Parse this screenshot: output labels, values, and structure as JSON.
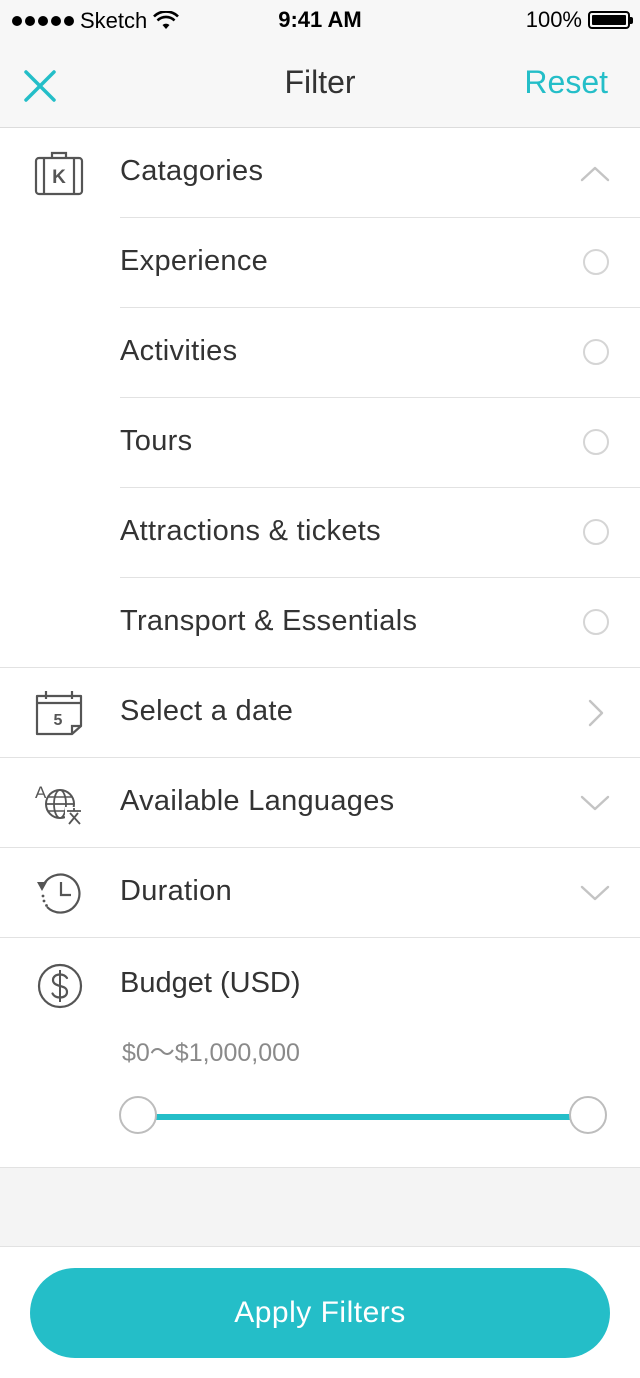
{
  "status_bar": {
    "carrier": "Sketch",
    "time": "9:41 AM",
    "battery": "100%"
  },
  "nav": {
    "title": "Filter",
    "reset_label": "Reset"
  },
  "categories": {
    "label": "Catagories",
    "icon_letter": "K",
    "expanded": true,
    "options": [
      {
        "label": "Experience",
        "selected": false
      },
      {
        "label": "Activities",
        "selected": false
      },
      {
        "label": "Tours",
        "selected": false
      },
      {
        "label": "Attractions & tickets",
        "selected": false
      },
      {
        "label": "Transport & Essentials",
        "selected": false
      }
    ]
  },
  "date": {
    "label": "Select a date",
    "icon_day": "5"
  },
  "languages": {
    "label": "Available Languages"
  },
  "duration": {
    "label": "Duration"
  },
  "budget": {
    "label": "Budget (USD)",
    "range_text": "$0～$1,000,000",
    "min": 0,
    "max": 1000000,
    "selected_min_fraction": 0,
    "selected_max_fraction": 1
  },
  "apply_label": "Apply Filters",
  "colors": {
    "accent": "#24bec8",
    "text": "#333333",
    "muted": "#8a8a8a",
    "divider": "#e2e2e2"
  },
  "icons": {
    "close": "close-icon",
    "categories": "luggage-icon",
    "date": "calendar-icon",
    "languages": "translate-icon",
    "duration": "history-clock-icon",
    "budget": "dollar-circle-icon"
  }
}
